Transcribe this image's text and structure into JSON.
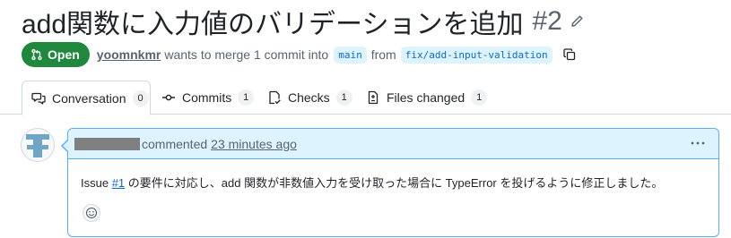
{
  "pull_request": {
    "title": "add関数に入力値のバリデーションを追加",
    "number": "#2",
    "state": "Open",
    "author": "yoomnkmr",
    "merge_text": "wants to merge 1 commit into",
    "base_branch": "main",
    "from_text": "from",
    "head_branch": "fix/add-input-validation"
  },
  "tabs": [
    {
      "label": "Conversation",
      "count": "0",
      "icon": "comment-discussion-icon"
    },
    {
      "label": "Commits",
      "count": "1",
      "icon": "git-commit-icon"
    },
    {
      "label": "Checks",
      "count": "1",
      "icon": "checklist-icon"
    },
    {
      "label": "Files changed",
      "count": "1",
      "icon": "file-diff-icon"
    }
  ],
  "comment": {
    "action": "commented",
    "time": "23 minutes ago",
    "body_prefix": "Issue ",
    "issue_ref": "#1",
    "body_suffix": " の要件に対応し、add 関数が非数値入力を受け取った場合に TypeError を投げるように修正しました。"
  },
  "colors": {
    "open_green": "#1f883d",
    "link_blue": "#0969da",
    "comment_header_bg": "#ddf4ff",
    "comment_border": "#54aeff"
  }
}
